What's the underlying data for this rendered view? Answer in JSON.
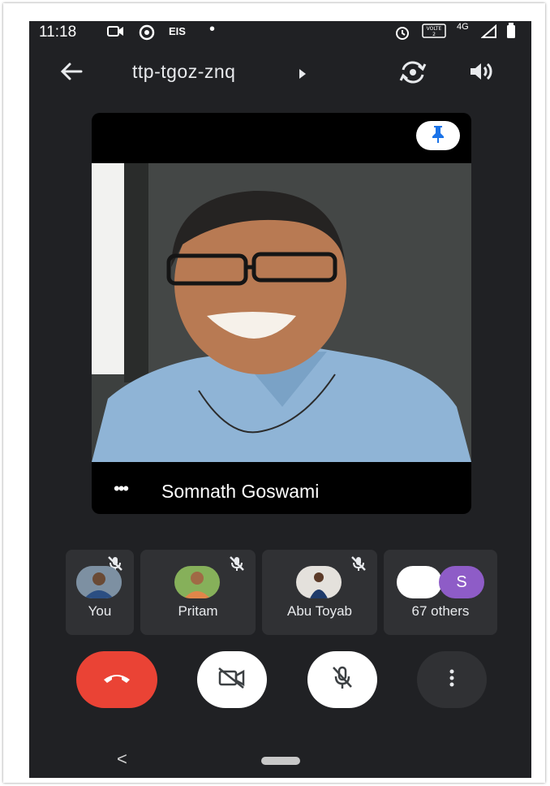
{
  "status_bar": {
    "time": "11:18",
    "carrier": "EIS",
    "network": "4G",
    "volte": "VOLTE"
  },
  "meeting": {
    "code": "ttp-tgoz-znq"
  },
  "main_tile": {
    "speaker_name": "Somnath Goswami",
    "more_label": "•••"
  },
  "participants": [
    {
      "name": "You",
      "muted": true
    },
    {
      "name": "Pritam",
      "muted": true
    },
    {
      "name": "Abu Toyab",
      "muted": true
    },
    {
      "name": "67 others",
      "avatar_letter": "S"
    }
  ],
  "controls": {
    "end_call_color": "#ea4335",
    "camera_state": "off",
    "mic_state": "off"
  },
  "colors": {
    "background": "#202124",
    "card": "#303134",
    "pin_icon": "#1a73e8",
    "others_avatar": "#8e5cc7"
  },
  "icons": [
    "back-arrow-icon",
    "camera-switch-icon",
    "speaker-icon",
    "pin-icon",
    "mic-off-icon",
    "end-call-icon",
    "camera-off-icon",
    "more-vert-icon"
  ]
}
